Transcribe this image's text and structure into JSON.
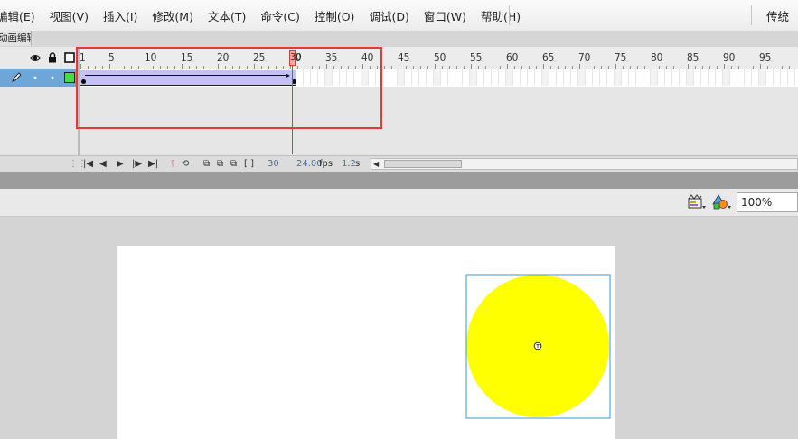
{
  "menubar": {
    "items": [
      "编辑(E)",
      "视图(V)",
      "插入(I)",
      "修改(M)",
      "文本(T)",
      "命令(C)",
      "控制(O)",
      "调试(D)",
      "窗口(W)",
      "帮助(H)"
    ],
    "workspace": "传统"
  },
  "panel_tabs": {
    "timeline_tab": "动画编辑器"
  },
  "timeline": {
    "ruler_labels": [
      "1",
      "5",
      "10",
      "15",
      "20",
      "25",
      "30",
      "35",
      "40",
      "45",
      "50",
      "55",
      "60",
      "65",
      "70",
      "75",
      "80",
      "85",
      "90",
      "95"
    ],
    "total_visible_frames": 99,
    "current_frame_label": "30",
    "tween_start_frame": 1,
    "tween_end_frame": 30,
    "layer_outline_color": "#44dd44",
    "status": {
      "current_frame": "30",
      "fps_value": "24.00",
      "fps_unit": "fps",
      "time_value": "1.2",
      "time_unit": "s"
    }
  },
  "stage_toolbar": {
    "zoom": "100%"
  },
  "colors": {
    "circle_fill": "#ffff00",
    "selection_box": "#3399dd",
    "highlight": "#e53935",
    "tween_fill": "#c4c2f2",
    "layer_selected": "#6fa6d9"
  }
}
